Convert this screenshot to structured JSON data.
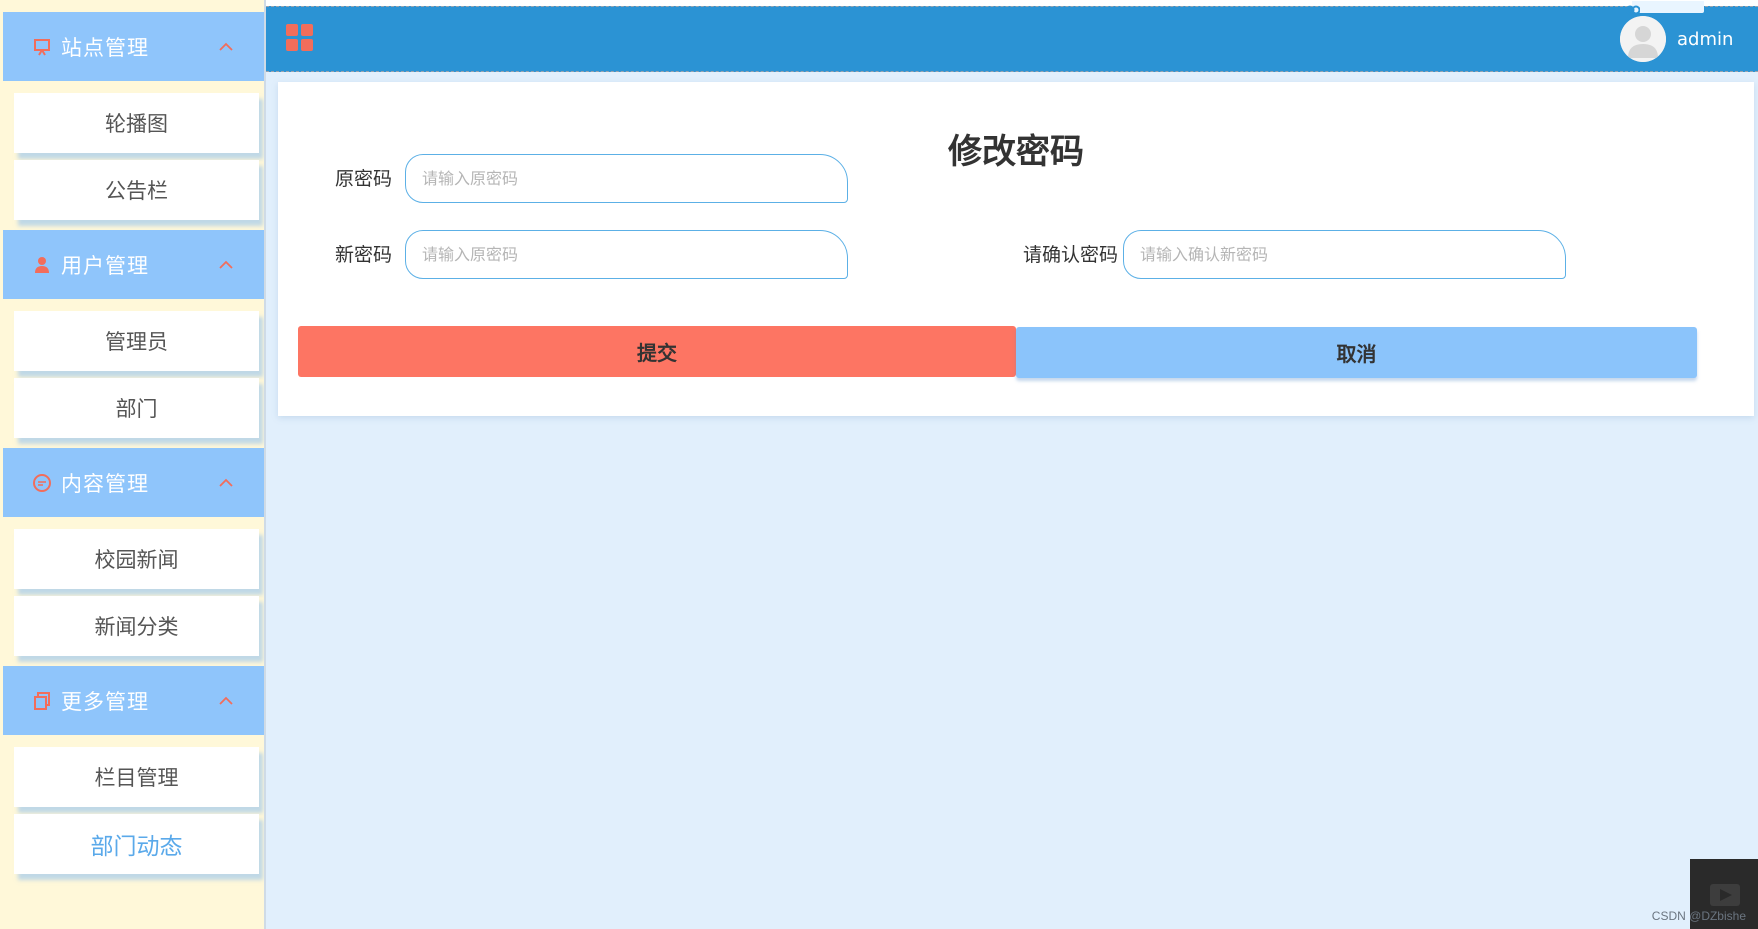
{
  "sidebar": {
    "groups": [
      {
        "label": "站点管理",
        "icon": "presentation-icon",
        "items": [
          "轮播图",
          "公告栏"
        ]
      },
      {
        "label": "用户管理",
        "icon": "user-icon",
        "items": [
          "管理员",
          "部门"
        ]
      },
      {
        "label": "内容管理",
        "icon": "chat-icon",
        "items": [
          "校园新闻",
          "新闻分类"
        ]
      },
      {
        "label": "更多管理",
        "icon": "copy-icon",
        "items": [
          "栏目管理",
          "部门动态"
        ]
      }
    ],
    "active_item": "部门动态"
  },
  "header": {
    "menu_icon": "grid-icon",
    "username": "admin",
    "avatar_icon": "avatar-icon"
  },
  "form": {
    "title": "修改密码",
    "old_password": {
      "label": "原密码",
      "placeholder": "请输入原密码",
      "value": ""
    },
    "new_password": {
      "label": "新密码",
      "placeholder": "请输入原密码",
      "value": ""
    },
    "confirm_password": {
      "label": "请确认密码",
      "placeholder": "请输入确认新密码",
      "value": ""
    },
    "submit_label": "提交",
    "cancel_label": "取消"
  },
  "watermark": "CSDN @DZbishe",
  "colors": {
    "sidebar_group_bg": "#8fc5fb",
    "sidebar_bg": "#fff8d9",
    "icon_accent": "#f26d5b",
    "topbar_bg": "#2b93d4",
    "main_bg": "#e1effc",
    "submit_bg": "#fd7563",
    "cancel_bg": "#8bc4fb",
    "active_item_text": "#5aa9ea"
  }
}
